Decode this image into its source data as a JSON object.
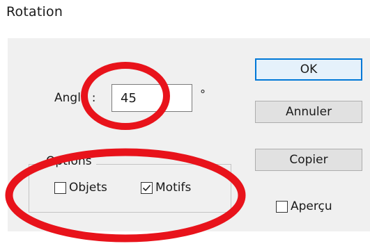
{
  "window": {
    "title": "Rotation"
  },
  "angle": {
    "label": "Angle :",
    "value": "45",
    "unit": "°"
  },
  "buttons": {
    "ok_label": "OK",
    "cancel_label": "Annuler",
    "copy_label": "Copier"
  },
  "options": {
    "legend": "Options",
    "objets": {
      "label": "Objets",
      "checked": false
    },
    "motifs": {
      "label": "Motifs",
      "checked": true
    }
  },
  "preview": {
    "label": "Aperçu",
    "checked": false
  },
  "colors": {
    "dialog_background": "#f0f0f0",
    "default_button_border": "#0078d7",
    "annotation_red": "#e8131b"
  }
}
